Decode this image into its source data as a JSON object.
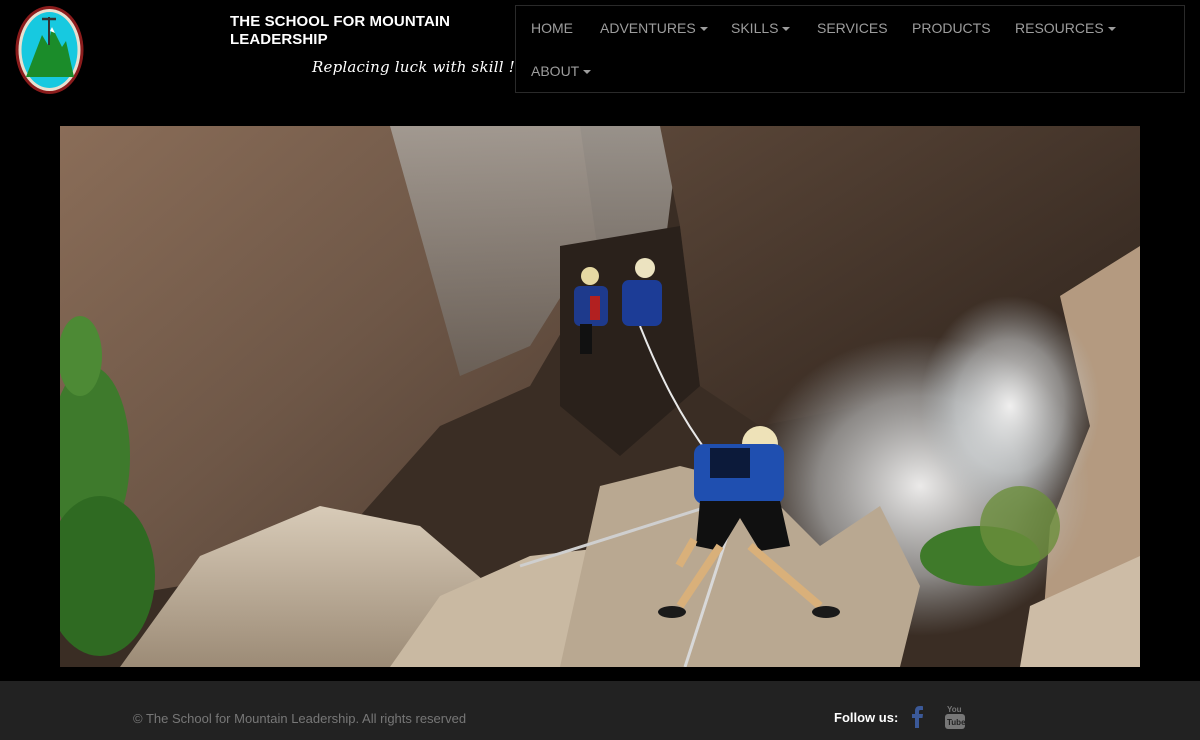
{
  "header": {
    "brand_title": "THE SCHOOL FOR MOUNTAIN LEADERSHIP",
    "tagline": "Replacing luck with skill !"
  },
  "nav": {
    "items": [
      {
        "label": "HOME",
        "dropdown": false
      },
      {
        "label": "ADVENTURES",
        "dropdown": true
      },
      {
        "label": "SKILLS",
        "dropdown": true
      },
      {
        "label": "SERVICES",
        "dropdown": false
      },
      {
        "label": "PRODUCTS",
        "dropdown": false
      },
      {
        "label": "RESOURCES",
        "dropdown": true
      },
      {
        "label": "ABOUT",
        "dropdown": true
      }
    ]
  },
  "footer": {
    "copyright": "© The School for Mountain Leadership. All rights reserved",
    "follow_label": "Follow us:",
    "social": [
      {
        "icon": "facebook-icon",
        "color": "#3b5998"
      },
      {
        "icon": "youtube-icon",
        "color": "#777777"
      }
    ]
  },
  "colors": {
    "background": "#000000",
    "footer_bg": "#222222",
    "nav_text": "#9d9d9d"
  }
}
